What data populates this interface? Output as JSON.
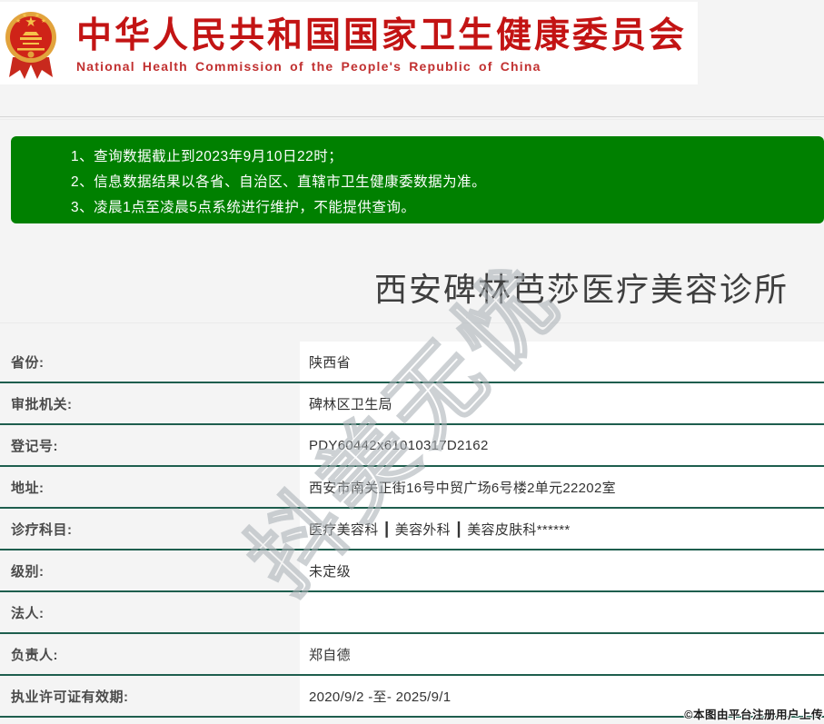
{
  "header": {
    "title_cn": "中华人民共和国国家卫生健康委员会",
    "title_en": "National Health Commission of the People's Republic of China"
  },
  "notice": {
    "lines": [
      "1、查询数据截止到2023年9月10日22时；",
      "2、信息数据结果以各省、自治区、直辖市卫生健康委数据为准。",
      "3、凌晨1点至凌晨5点系统进行维护，不能提供查询。"
    ]
  },
  "clinic": {
    "name": "西安碑林芭莎医疗美容诊所",
    "rows": [
      {
        "label": "省份:",
        "value": "陕西省"
      },
      {
        "label": "审批机关:",
        "value": "碑林区卫生局"
      },
      {
        "label": "登记号:",
        "value": "PDY60442x61010317D2162"
      },
      {
        "label": "地址:",
        "value": "西安市南关正街16号中贸广场6号楼2单元22202室"
      },
      {
        "label": "诊疗科目:",
        "value": "医疗美容科 ┃ 美容外科 ┃ 美容皮肤科******"
      },
      {
        "label": "级别:",
        "value": "未定级"
      },
      {
        "label": "法人:",
        "value": ""
      },
      {
        "label": "负责人:",
        "value": "郑自德"
      },
      {
        "label": "执业许可证有效期:",
        "value": "2020/9/2 -至- 2025/9/1"
      }
    ]
  },
  "watermark": "抖美无忧",
  "footer_note": "©本图由平台注册用户上传",
  "colors": {
    "header_red": "#c31414",
    "notice_green": "#008000",
    "separator_green": "#1e5e4e",
    "label_bg": "#f4f4f4",
    "page_bg": "#f4f4f4"
  }
}
